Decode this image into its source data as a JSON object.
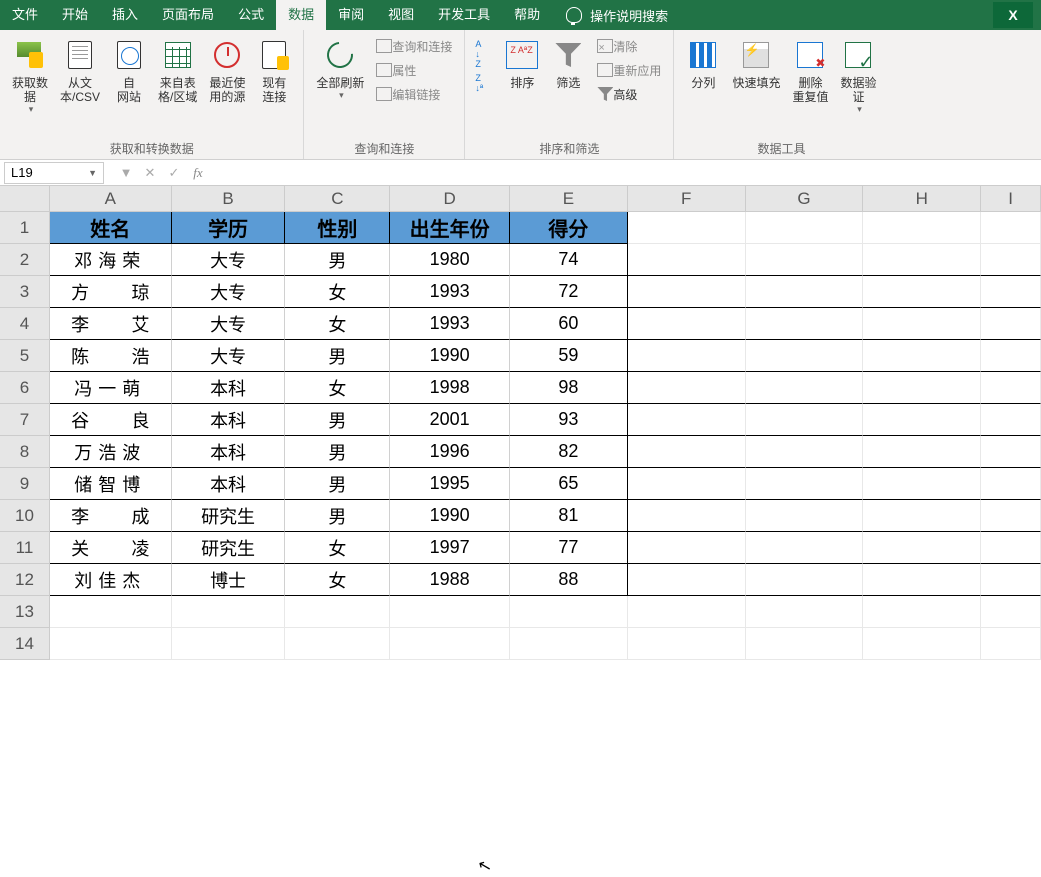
{
  "menubar": {
    "tabs": [
      "文件",
      "开始",
      "插入",
      "页面布局",
      "公式",
      "数据",
      "审阅",
      "视图",
      "开发工具",
      "帮助"
    ],
    "active_index": 5,
    "search_placeholder": "操作说明搜索"
  },
  "ribbon": {
    "groups": {
      "get_transform": {
        "label": "获取和转换数据",
        "buttons": {
          "get_data": "获取数\n据",
          "from_text": "从文\n本/CSV",
          "from_web": "自\n网站",
          "from_table": "来自表\n格/区域",
          "recent": "最近使\n用的源",
          "existing": "现有\n连接"
        }
      },
      "queries": {
        "label": "查询和连接",
        "refresh_all": "全部刷新",
        "items": {
          "queries_conn": "查询和连接",
          "properties": "属性",
          "edit_links": "编辑链接"
        }
      },
      "sort_filter": {
        "label": "排序和筛选",
        "sort": "排序",
        "filter": "筛选",
        "items": {
          "clear": "清除",
          "reapply": "重新应用",
          "advanced": "高级"
        }
      },
      "data_tools": {
        "label": "数据工具",
        "text_to_cols": "分列",
        "flash_fill": "快速填充",
        "remove_dup": "删除\n重复值",
        "data_valid": "数据验\n证"
      }
    }
  },
  "formula_bar": {
    "name_box": "L19",
    "formula": ""
  },
  "sheet": {
    "columns": [
      "A",
      "B",
      "C",
      "D",
      "E",
      "F",
      "G",
      "H",
      "I"
    ],
    "col_widths": [
      "cw-A",
      "cw-B",
      "cw-C",
      "cw-D",
      "cw-E",
      "cw-F",
      "cw-G",
      "cw-H",
      "cw-I"
    ],
    "headers": [
      "姓名",
      "学历",
      "性别",
      "出生年份",
      "得分"
    ],
    "rows": [
      {
        "name": "邓海荣",
        "name_sp3": true,
        "edu": "大专",
        "sex": "男",
        "year": "1980",
        "score": "74"
      },
      {
        "name_parts": [
          "方",
          "琼"
        ],
        "edu": "大专",
        "sex": "女",
        "year": "1993",
        "score": "72"
      },
      {
        "name_parts": [
          "李",
          "艾"
        ],
        "edu": "大专",
        "sex": "女",
        "year": "1993",
        "score": "60"
      },
      {
        "name_parts": [
          "陈",
          "浩"
        ],
        "edu": "大专",
        "sex": "男",
        "year": "1990",
        "score": "59"
      },
      {
        "name": "冯一萌",
        "name_sp3": true,
        "edu": "本科",
        "sex": "女",
        "year": "1998",
        "score": "98"
      },
      {
        "name_parts": [
          "谷",
          "良"
        ],
        "edu": "本科",
        "sex": "男",
        "year": "2001",
        "score": "93"
      },
      {
        "name": "万浩波",
        "name_sp3": true,
        "edu": "本科",
        "sex": "男",
        "year": "1996",
        "score": "82"
      },
      {
        "name": "储智博",
        "name_sp3": true,
        "edu": "本科",
        "sex": "男",
        "year": "1995",
        "score": "65"
      },
      {
        "name_parts": [
          "李",
          "成"
        ],
        "edu": "研究生",
        "sex": "男",
        "year": "1990",
        "score": "81"
      },
      {
        "name_parts": [
          "关",
          "凌"
        ],
        "edu": "研究生",
        "sex": "女",
        "year": "1997",
        "score": "77"
      },
      {
        "name": "刘佳杰",
        "name_sp3": true,
        "edu": "博士",
        "sex": "女",
        "year": "1988",
        "score": "88"
      }
    ],
    "empty_rows": [
      13,
      14
    ]
  }
}
